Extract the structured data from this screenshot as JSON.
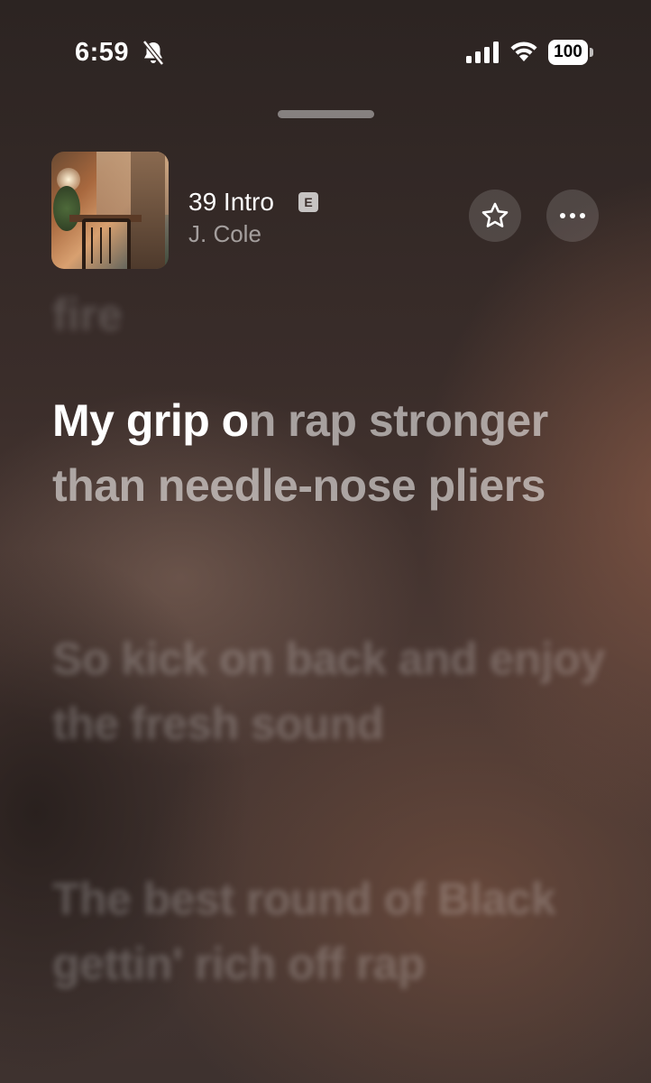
{
  "status_bar": {
    "time": "6:59",
    "battery": "100",
    "icons": [
      "bell-slash-icon",
      "cellular-signal-icon",
      "wifi-icon",
      "battery-icon"
    ]
  },
  "now_playing": {
    "title": "39 Intro",
    "explicit_badge": "E",
    "artist": "J. Cole",
    "buttons": [
      "star-icon",
      "more-icon"
    ]
  },
  "lyrics": {
    "previous": "fire",
    "current": {
      "sung": "My grip o",
      "unsung": "n rap stronger than needle-nose pliers"
    },
    "upcoming": [
      "So kick on back and enjoy the fresh sound",
      "The best round of Black gettin' rich off rap"
    ]
  },
  "colors": {
    "background": "#3a2d2a",
    "accent_warm": "#8c5c48"
  }
}
